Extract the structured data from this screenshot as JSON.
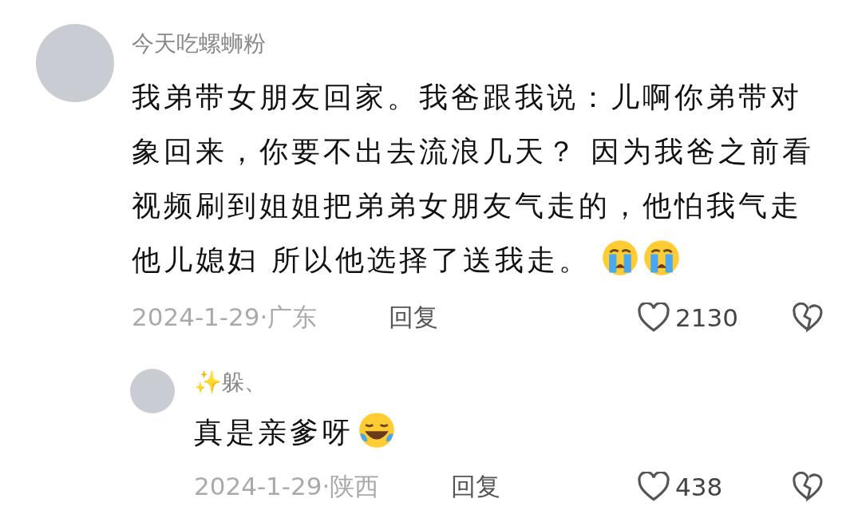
{
  "comment": {
    "username": "今天吃螺蛳粉",
    "text": "我弟带女朋友回家。我爸跟我说：儿啊你弟带对象回来，你要不出去流浪几天？ 因为我爸之前看视频刷到姐姐把弟弟女朋友气走的，他怕我气走他儿媳妇 所以他选择了送我走。",
    "emojis": [
      {
        "kind": "crying"
      },
      {
        "kind": "crying"
      }
    ],
    "date": "2024-1-29·广东",
    "reply_label": "回复",
    "likes": "2130"
  },
  "reply": {
    "username": "✨躲、",
    "text": "真是亲爹呀",
    "emojis": [
      {
        "kind": "laughing"
      }
    ],
    "date": "2024-1-29·陕西",
    "reply_label": "回复",
    "likes": "438"
  }
}
